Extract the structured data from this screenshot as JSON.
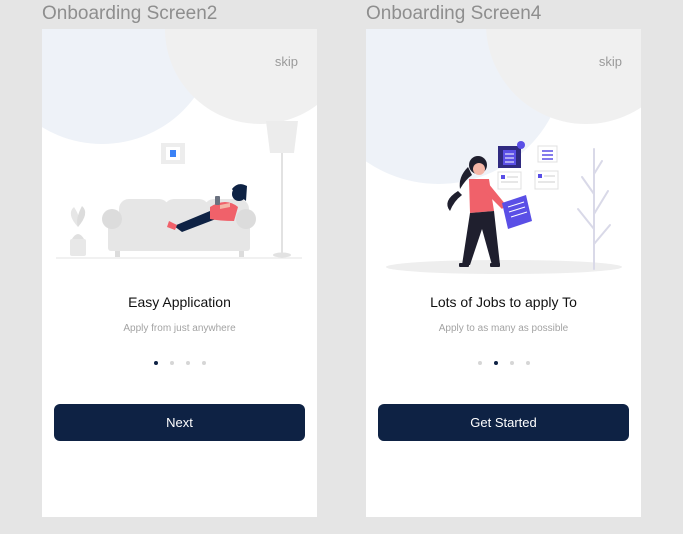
{
  "screens": [
    {
      "frame_title": "Onboarding Screen2",
      "skip_label": "skip",
      "heading": "Easy Application",
      "subtitle": "Apply from just anywhere",
      "button_label": "Next",
      "page_indicator": {
        "total": 4,
        "active": 1
      }
    },
    {
      "frame_title": "Onboarding Screen4",
      "skip_label": "skip",
      "heading": "Lots of Jobs to apply To",
      "subtitle": "Apply to as many as possible",
      "button_label": "Get Started",
      "page_indicator": {
        "total": 4,
        "active": 2
      }
    }
  ],
  "colors": {
    "canvas_bg": "#e5e5e5",
    "primary": "#0e2244",
    "accent_person": "#f0616a",
    "accent_doc": "#5a4fe6",
    "blob_blue": "#eef2f8",
    "blob_grey": "#f0f0f0",
    "dot_inactive": "#d6d6d6"
  },
  "icons": [
    "sofa-person-illustration",
    "job-documents-illustration"
  ]
}
